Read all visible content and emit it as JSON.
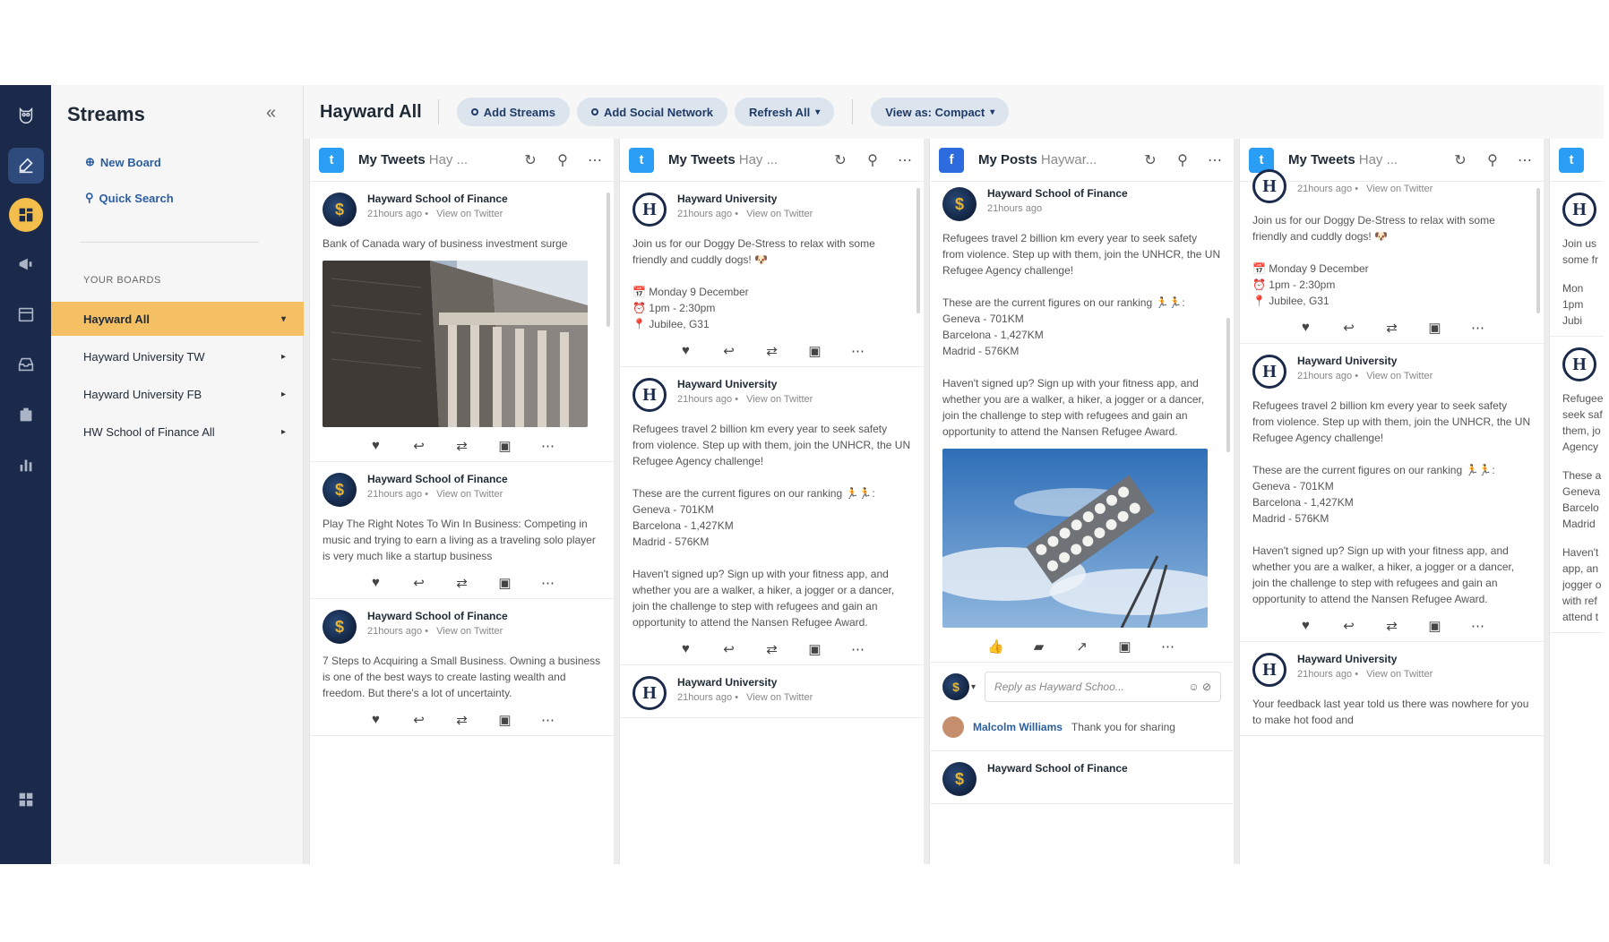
{
  "rail": {
    "items": [
      "owl-logo",
      "compose",
      "streams",
      "publisher",
      "planner",
      "inbox",
      "assignments",
      "analytics",
      "apps"
    ]
  },
  "streams_panel": {
    "title": "Streams",
    "collapse": "«",
    "new_board": "New Board",
    "quick_search": "Quick Search",
    "boards_label": "YOUR BOARDS",
    "boards": [
      {
        "label": "Hayward All",
        "active": true
      },
      {
        "label": "Hayward University TW",
        "active": false
      },
      {
        "label": "Hayward University FB",
        "active": false
      },
      {
        "label": "HW School of Finance All",
        "active": false
      }
    ]
  },
  "topbar": {
    "board_title": "Hayward All",
    "add_streams": "Add Streams",
    "add_social": "Add Social Network",
    "refresh": "Refresh All",
    "view_as": "View as: Compact"
  },
  "columns": [
    {
      "network": "twitter",
      "title": "My Tweets",
      "subtitle": "Hay ...",
      "posts": [
        {
          "author": "Hayward School of Finance",
          "time": "21hours ago",
          "link": "View on Twitter",
          "text": "Bank of Canada wary of business investment surge",
          "image": "building"
        },
        {
          "author": "Hayward School of Finance",
          "time": "21hours ago",
          "link": "View on Twitter",
          "text": "Play The Right Notes To Win In Business: Competing in music and trying to earn a living as a traveling solo player is very much like a startup business"
        },
        {
          "author": "Hayward School of Finance",
          "time": "21hours ago",
          "link": "View on Twitter",
          "text": "7 Steps to Acquiring a Small Business. Owning a business is one of the best ways to create lasting wealth and freedom. But there's a lot of uncertainty."
        }
      ]
    },
    {
      "network": "twitter",
      "title": "My Tweets",
      "subtitle": "Hay ...",
      "posts": [
        {
          "author": "Hayward University",
          "time": "21hours ago",
          "link": "View on Twitter",
          "text": "Join us for our Doggy De-Stress to relax with some friendly and cuddly dogs! 🐶\n\n📅 Monday 9 December\n⏰ 1pm - 2:30pm\n📍 Jubilee, G31"
        },
        {
          "author": "Hayward University",
          "time": "21hours ago",
          "link": "View on Twitter",
          "text": "Refugees travel 2 billion km every year to seek safety from violence. Step up with them, join the UNHCR, the UN Refugee Agency challenge!\n\nThese are the current figures on our ranking 🏃🏃:\nGeneva - 701KM\nBarcelona - 1,427KM\nMadrid - 576KM\n\nHaven't signed up? Sign up with your fitness app, and whether you are a walker, a hiker, a jogger or a dancer, join the challenge to step with refugees and gain an opportunity to attend the Nansen Refugee Award."
        },
        {
          "author": "Hayward University",
          "time": "21hours ago",
          "link": "View on Twitter",
          "text": ""
        }
      ]
    },
    {
      "network": "facebook",
      "title": "My Posts",
      "subtitle": "Haywar...",
      "posts": [
        {
          "author": "Hayward School of Finance",
          "time": "21hours ago",
          "link": "",
          "text": "Refugees travel 2 billion km every year to seek safety from violence. Step up with them, join the UNHCR, the UN Refugee Agency challenge!\n\nThese are the current figures on our ranking 🏃🏃:\nGeneva - 701KM\nBarcelona - 1,427KM\nMadrid - 576KM\n\nHaven't signed up? Sign up with your fitness app, and whether you are a walker, a hiker, a jogger or a dancer, join the challenge to step with refugees and gain an opportunity to attend the Nansen Refugee Award.",
          "image": "sky"
        }
      ],
      "reply_placeholder": "Reply as Hayward Schoo...",
      "comment": {
        "name": "Malcolm Williams",
        "text": "Thank you for sharing"
      },
      "next_author": "Hayward School of Finance"
    },
    {
      "network": "twitter",
      "title": "My Tweets",
      "subtitle": "Hay ...",
      "posts": [
        {
          "author": "",
          "time": "21hours ago",
          "link": "View on Twitter",
          "text": "Join us for our Doggy De-Stress to relax with some friendly and cuddly dogs! 🐶\n\n📅 Monday 9 December\n⏰ 1pm - 2:30pm\n📍 Jubilee, G31"
        },
        {
          "author": "Hayward University",
          "time": "21hours ago",
          "link": "View on Twitter",
          "text": "Refugees travel 2 billion km every year to seek safety from violence. Step up with them, join the UNHCR, the UN Refugee Agency challenge!\n\nThese are the current figures on our ranking 🏃🏃:\nGeneva - 701KM\nBarcelona - 1,427KM\nMadrid - 576KM\n\nHaven't signed up? Sign up with your fitness app, and whether you are a walker, a hiker, a jogger or a dancer, join the challenge to step with refugees and gain an opportunity to attend the Nansen Refugee Award."
        },
        {
          "author": "Hayward University",
          "time": "21hours ago",
          "link": "View on Twitter",
          "text": "Your feedback last year told us there was nowhere for you to make hot food and"
        }
      ]
    }
  ],
  "partial_column": {
    "network": "twitter",
    "snippets": [
      "Join us",
      "some fr",
      "Mon",
      "1pm",
      "Jubi",
      "Refugee",
      "seek saf",
      "them, jo",
      "Agency",
      "These a",
      "Geneva",
      "Barcelo",
      "Madrid",
      "Haven't",
      "app, an",
      "jogger o",
      "with ref",
      "attend t"
    ]
  },
  "colors": {
    "rail": "#1b2a4a",
    "accent": "#f4c063",
    "twitter": "#2a9df4",
    "facebook": "#2d6cdf"
  }
}
